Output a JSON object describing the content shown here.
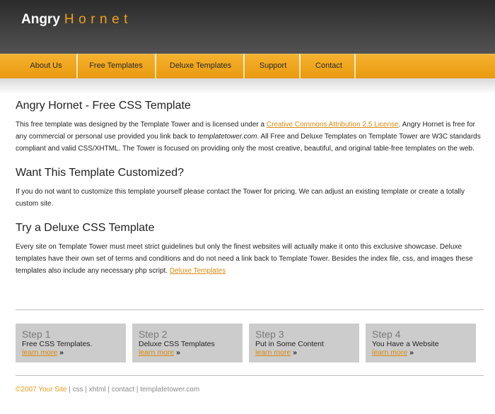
{
  "header": {
    "logo_main": "Angry",
    "logo_accent": "Hornet"
  },
  "nav": [
    "About Us",
    "Free Templates",
    "Deluxe Templates",
    "Support",
    "Contact"
  ],
  "sections": [
    {
      "title": "Angry Hornet - Free CSS Template",
      "body1": "This free template was designed by the Template Tower and is licensed under a ",
      "link": "Creative Commons Attribution 2.5 License",
      "body2": ". Angry Hornet is free for any commercial or personal use provided you link back to ",
      "italic": "templatetower.com",
      "body3": ". All Free and Deluxe Templates on Template Tower are W3C standards compliant and valid CSS/XHTML. The Tower is focused on providing only the most creative, beautiful, and original table-free templates on the web."
    },
    {
      "title": "Want This Template Customized?",
      "body": "If you do not want to customize this template yourself please contact the Tower for pricing. We can adjust an existing template or create a totally custom site."
    },
    {
      "title": "Try a Deluxe CSS Template",
      "body": "Every site on Template Tower must meet strict guidelines but only the finest websites will actually make it onto this exclusive showcase. Deluxe templates have their own set of terms and conditions and do not need a link back to Template Tower. Besides the index file, css, and images these templates also include any necessary php script. ",
      "link": "Deluxe Templates"
    }
  ],
  "steps": [
    {
      "title": "Step 1",
      "desc": "Free CSS Templates.",
      "more": "learn more",
      "arrow": "»"
    },
    {
      "title": "Step 2",
      "desc": "Deluxe CSS Templates",
      "more": "learn more",
      "arrow": "»"
    },
    {
      "title": "Step 3",
      "desc": "Put in Some Content",
      "more": "learn more",
      "arrow": "»"
    },
    {
      "title": "Step 4",
      "desc": "You Have a Website",
      "more": "learn more",
      "arrow": "»"
    }
  ],
  "footer": {
    "copyright": "©2007 Your Site",
    "links": [
      "css",
      "xhtml",
      "contact",
      "templatetower.com"
    ],
    "separator": " | "
  },
  "colors": {
    "accent": "#f0a01a",
    "header_bg": "#3a3a3a",
    "nav_bg": "#f2a823",
    "step_bg": "#cccccc"
  }
}
